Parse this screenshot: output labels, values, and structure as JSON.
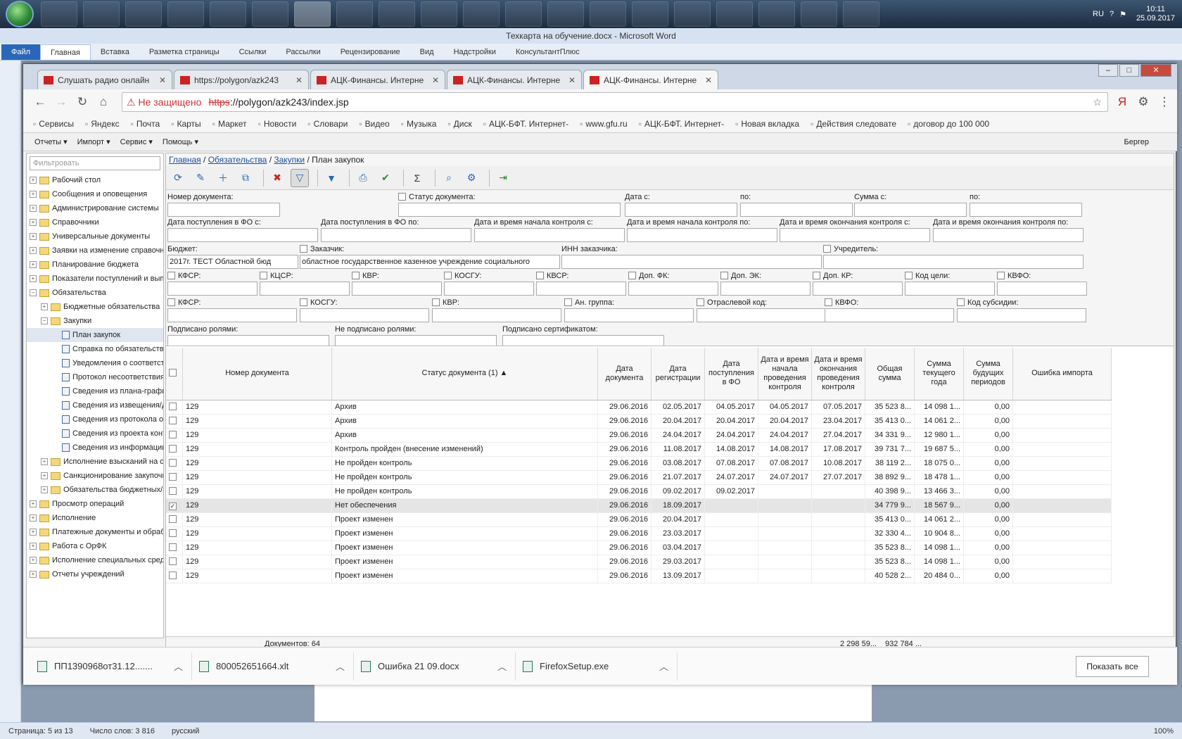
{
  "taskbar": {
    "apps": [
      "Explorer",
      "Media",
      "IE",
      "Ps",
      "Game",
      "Acrobat",
      "Chrome",
      "Firefox",
      "Box",
      "W",
      "Calc1",
      "Paint",
      "Notes",
      "Net",
      "Teams",
      "Vbox",
      "Calc",
      "Gear",
      "Art",
      "Gear2"
    ],
    "lang": "RU",
    "time": "10:11",
    "date": "25.09.2017"
  },
  "word": {
    "title": "Техкарта на обучение.docx - Microsoft Word",
    "ribbon_tabs": [
      "Файл",
      "Главная",
      "Вставка",
      "Разметка страницы",
      "Ссылки",
      "Рассылки",
      "Рецензирование",
      "Вид",
      "Надстройки",
      "КонсультантПлюс"
    ],
    "status": {
      "page": "Страница: 5 из 13",
      "words": "Число слов: 3 816",
      "lang": "русский",
      "zoom": "100%"
    }
  },
  "chrome": {
    "tabs": [
      "Слушать радио онлайн",
      "https://polygon/azk243",
      "АЦК-Финансы. Интерне",
      "АЦК-Финансы. Интерне",
      "АЦК-Финансы. Интерне"
    ],
    "warn": "Не защищено",
    "url_scheme": "https",
    "url_rest": "://polygon/azk243/index.jsp",
    "bookmarks": [
      "Сервисы",
      "Яндекс",
      "Почта",
      "Карты",
      "Маркет",
      "Новости",
      "Словари",
      "Видео",
      "Музыка",
      "Диск",
      "АЦК-БФТ. Интернет-",
      "www.gfu.ru",
      "АЦК-БФТ. Интернет-",
      "Новая вкладка",
      "Действия следовате",
      "договор до 100 000"
    ]
  },
  "app": {
    "menu": [
      "Отчеты ▾",
      "Импорт ▾",
      "Сервис ▾",
      "Помощь ▾"
    ],
    "user": "Бергер",
    "filter_placeholder": "Фильтровать",
    "tree": [
      {
        "l": "Рабочий стол",
        "d": 0,
        "t": "f"
      },
      {
        "l": "Сообщения и оповещения",
        "d": 0,
        "t": "f"
      },
      {
        "l": "Администрирование системы",
        "d": 0,
        "t": "f"
      },
      {
        "l": "Справочники",
        "d": 0,
        "t": "f"
      },
      {
        "l": "Универсальные документы",
        "d": 0,
        "t": "f"
      },
      {
        "l": "Заявки на изменение справочни",
        "d": 0,
        "t": "f"
      },
      {
        "l": "Планирование бюджета",
        "d": 0,
        "t": "f"
      },
      {
        "l": "Показатели поступлений и выпл",
        "d": 0,
        "t": "f"
      },
      {
        "l": "Обязательства",
        "d": 0,
        "t": "o"
      },
      {
        "l": "Бюджетные обязательства",
        "d": 1,
        "t": "f"
      },
      {
        "l": "Закупки",
        "d": 1,
        "t": "o"
      },
      {
        "l": "План закупок",
        "d": 2,
        "t": "d",
        "sel": true
      },
      {
        "l": "Справка по обязательства",
        "d": 2,
        "t": "d"
      },
      {
        "l": "Уведомления о соответст",
        "d": 2,
        "t": "d"
      },
      {
        "l": "Протокол несоответствия",
        "d": 2,
        "t": "d"
      },
      {
        "l": "Сведения из плана-графи",
        "d": 2,
        "t": "d"
      },
      {
        "l": "Сведения из извещения/д",
        "d": 2,
        "t": "d"
      },
      {
        "l": "Сведения из протокола ог",
        "d": 2,
        "t": "d"
      },
      {
        "l": "Сведения из проекта конт",
        "d": 2,
        "t": "d"
      },
      {
        "l": "Сведения из информации",
        "d": 2,
        "t": "d"
      },
      {
        "l": "Исполнение взысканий на ср",
        "d": 1,
        "t": "f"
      },
      {
        "l": "Санкционирование закупочн",
        "d": 1,
        "t": "f"
      },
      {
        "l": "Обязательства бюджетных/а",
        "d": 1,
        "t": "f"
      },
      {
        "l": "Просмотр операций",
        "d": 0,
        "t": "f"
      },
      {
        "l": "Исполнение",
        "d": 0,
        "t": "f"
      },
      {
        "l": "Платежные документы и обрабо",
        "d": 0,
        "t": "f"
      },
      {
        "l": "Работа с ОрФК",
        "d": 0,
        "t": "f"
      },
      {
        "l": "Исполнение специальных средс",
        "d": 0,
        "t": "f"
      },
      {
        "l": "Отчеты учреждений",
        "d": 0,
        "t": "f"
      }
    ],
    "breadcrumb": [
      "Главная",
      "Обязательства",
      "Закупки",
      "План закупок"
    ],
    "filters": {
      "labels": [
        "Номер документа:",
        "Статус документа:",
        "Дата с:",
        "по:",
        "Сумма с:",
        "по:",
        "Дата поступления в ФО с:",
        "Дата поступления в ФО по:",
        "Дата и время начала контроля с:",
        "Дата и время начала контроля по:",
        "Дата и время окончания контроля с:",
        "Дата и время окончания контроля по:",
        "Бюджет:",
        "Заказчик:",
        "ИНН заказчика:",
        "Учредитель:",
        "КФСР:",
        "КЦСР:",
        "КВР:",
        "КОСГУ:",
        "КВСР:",
        "Доп. ФК:",
        "Доп. ЭК:",
        "Доп. КР:",
        "Код цели:",
        "КВФО:",
        "КФСР:",
        "КОСГУ:",
        "КВР:",
        "Ан. группа:",
        "Отраслевой код:",
        "КВФО:",
        "Код субсидии:",
        "Подписано ролями:",
        "Не подписано ролями:",
        "Подписано сертификатом:"
      ],
      "budget": "2017г. ТЕСТ Областной бюд",
      "customer": "областное государственное казенное учреждение социального"
    },
    "columns": [
      "Номер документа",
      "Статус документа (1) ▲",
      "Дата документа",
      "Дата регистрации",
      "Дата поступления в ФО",
      "Дата и время начала проведения контроля",
      "Дата и время окончания проведения контроля",
      "Общая сумма",
      "Сумма текущего года",
      "Сумма будущих периодов",
      "Ошибка импорта"
    ],
    "rows": [
      [
        "129",
        "Архив",
        "29.06.2016",
        "02.05.2017",
        "04.05.2017",
        "04.05.2017",
        "07.05.2017",
        "35 523 8...",
        "14 098 1...",
        "0,00"
      ],
      [
        "129",
        "Архив",
        "29.06.2016",
        "20.04.2017",
        "20.04.2017",
        "20.04.2017",
        "23.04.2017",
        "35 413 0...",
        "14 061 2...",
        "0,00"
      ],
      [
        "129",
        "Архив",
        "29.06.2016",
        "24.04.2017",
        "24.04.2017",
        "24.04.2017",
        "27.04.2017",
        "34 331 9...",
        "12 980 1...",
        "0,00"
      ],
      [
        "129",
        "Контроль пройден (внесение изменений)",
        "29.06.2016",
        "11.08.2017",
        "14.08.2017",
        "14.08.2017",
        "17.08.2017",
        "39 731 7...",
        "19 687 5...",
        "0,00"
      ],
      [
        "129",
        "Не пройден контроль",
        "29.06.2016",
        "03.08.2017",
        "07.08.2017",
        "07.08.2017",
        "10.08.2017",
        "38 119 2...",
        "18 075 0...",
        "0,00"
      ],
      [
        "129",
        "Не пройден контроль",
        "29.06.2016",
        "21.07.2017",
        "24.07.2017",
        "24.07.2017",
        "27.07.2017",
        "38 892 9...",
        "18 478 1...",
        "0,00"
      ],
      [
        "129",
        "Не пройден контроль",
        "29.06.2016",
        "09.02.2017",
        "09.02.2017",
        "",
        "",
        "40 398 9...",
        "13 466 3...",
        "0,00"
      ],
      [
        "129",
        "Нет обеспечения",
        "29.06.2016",
        "18.09.2017",
        "",
        "",
        "",
        "34 779 9...",
        "18 567 9...",
        "0,00"
      ],
      [
        "129",
        "Проект изменен",
        "29.06.2016",
        "20.04.2017",
        "",
        "",
        "",
        "35 413 0...",
        "14 061 2...",
        "0,00"
      ],
      [
        "129",
        "Проект изменен",
        "29.06.2016",
        "23.03.2017",
        "",
        "",
        "",
        "32 330 4...",
        "10 904 8...",
        "0,00"
      ],
      [
        "129",
        "Проект изменен",
        "29.06.2016",
        "03.04.2017",
        "",
        "",
        "",
        "35 523 8...",
        "14 098 1...",
        "0,00"
      ],
      [
        "129",
        "Проект изменен",
        "29.06.2016",
        "29.03.2017",
        "",
        "",
        "",
        "35 523 8...",
        "14 098 1...",
        "0,00"
      ],
      [
        "129",
        "Проект изменен",
        "29.06.2016",
        "13.09.2017",
        "",
        "",
        "",
        "40 528 2...",
        "20 484 0...",
        "0,00"
      ]
    ],
    "selected_row": 7,
    "footer": {
      "count": "Документов: 64",
      "total": "2 298 59...",
      "current": "932 784 ..."
    }
  },
  "downloads": {
    "items": [
      "ПП1390968от31.12.......",
      "800052651664.xlt",
      "Ошибка 21 09.docx",
      "FirefoxSetup.exe"
    ],
    "show_all": "Показать все"
  }
}
